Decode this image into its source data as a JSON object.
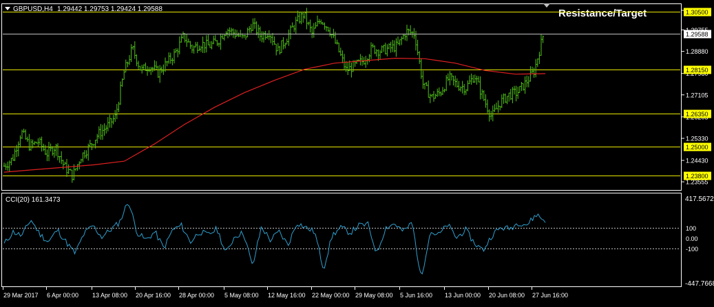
{
  "header": {
    "symbol": "GBPUSD,H4",
    "ohlc": "1.29442 1.29753 1.29424 1.29588",
    "annotation": "Resistance/Target"
  },
  "indicator": {
    "label": "CCI(20) 161.3473",
    "top_value": "417.5672",
    "bottom_value": "-447.7668",
    "levels": [
      100,
      0,
      -100
    ],
    "level_labels": [
      "100",
      "0.00",
      "-100"
    ]
  },
  "colors": {
    "background": "#000000",
    "frame": "#ffffff",
    "bars": "#52c41a",
    "moving_average": "#e02020",
    "level_lines": "#e8e800",
    "level_label_bg": "#ffff00",
    "cci_line": "#2fa0d0",
    "text": "#ffffff"
  },
  "chart_data": [
    {
      "type": "bar",
      "title": "GBPUSD,H4",
      "ylim": [
        1.2325,
        1.3078
      ],
      "y_axis_ticks": [
        "1.30555",
        "1.29755",
        "1.28880",
        "1.27980",
        "1.27105",
        "1.26205",
        "1.25330",
        "1.24430",
        "1.23555"
      ],
      "x_axis_ticks": [
        "29 Mar 2017",
        "6 Apr 00:00",
        "13 Apr 08:00",
        "20 Apr 16:00",
        "28 Apr 00:00",
        "5 May 08:00",
        "12 May 16:00",
        "22 May 00:00",
        "29 May 08:00",
        "5 Jun 16:00",
        "13 Jun 00:00",
        "20 Jun 08:00",
        "27 Jun 16:00"
      ],
      "horizontal_levels": [
        {
          "value": 1.305,
          "label": "1.30500"
        },
        {
          "value": 1.2815,
          "label": "1.28150"
        },
        {
          "value": 1.2635,
          "label": "1.26350"
        },
        {
          "value": 1.25,
          "label": "1.25000"
        },
        {
          "value": 1.238,
          "label": "1.23800"
        }
      ],
      "current_price": {
        "value": 1.29588,
        "label": "1.29588"
      },
      "price_path": [
        1.242,
        1.245,
        1.256,
        1.25,
        1.252,
        1.247,
        1.25,
        1.242,
        1.238,
        1.246,
        1.25,
        1.255,
        1.258,
        1.262,
        1.28,
        1.29,
        1.281,
        1.283,
        1.28,
        1.284,
        1.288,
        1.295,
        1.29,
        1.292,
        1.291,
        1.293,
        1.298,
        1.296,
        1.294,
        1.3,
        1.295,
        1.297,
        1.289,
        1.294,
        1.3,
        1.304,
        1.296,
        1.302,
        1.298,
        1.29,
        1.281,
        1.283,
        1.285,
        1.29,
        1.289,
        1.29,
        1.291,
        1.297,
        1.296,
        1.275,
        1.27,
        1.272,
        1.278,
        1.275,
        1.274,
        1.279,
        1.27,
        1.262,
        1.268,
        1.271,
        1.272,
        1.276,
        1.281,
        1.295
      ],
      "moving_average_path": [
        1.2395,
        1.2405,
        1.2415,
        1.2425,
        1.244,
        1.251,
        1.259,
        1.266,
        1.272,
        1.277,
        1.2815,
        1.284,
        1.285,
        1.286,
        1.2858,
        1.284,
        1.281,
        1.2795,
        1.2797
      ]
    },
    {
      "type": "line",
      "title": "CCI(20)",
      "ylim": [
        -447.7668,
        417.5672
      ],
      "levels": [
        100,
        0,
        -100
      ],
      "series": [
        {
          "values": [
            -60,
            60,
            20,
            180,
            40,
            -40,
            80,
            -40,
            -150,
            40,
            120,
            10,
            80,
            150,
            360,
            50,
            -20,
            60,
            -100,
            80,
            120,
            -40,
            60,
            30,
            90,
            -150,
            20,
            50,
            -280,
            110,
            -20,
            60,
            -70,
            150,
            100,
            60,
            -300,
            30,
            100,
            50,
            120,
            130,
            -150,
            100,
            140,
            60,
            150,
            -400,
            60,
            30,
            130,
            0,
            80,
            -50,
            -120,
            30,
            100,
            90,
            150,
            130,
            230,
            161
          ]
        }
      ]
    }
  ]
}
